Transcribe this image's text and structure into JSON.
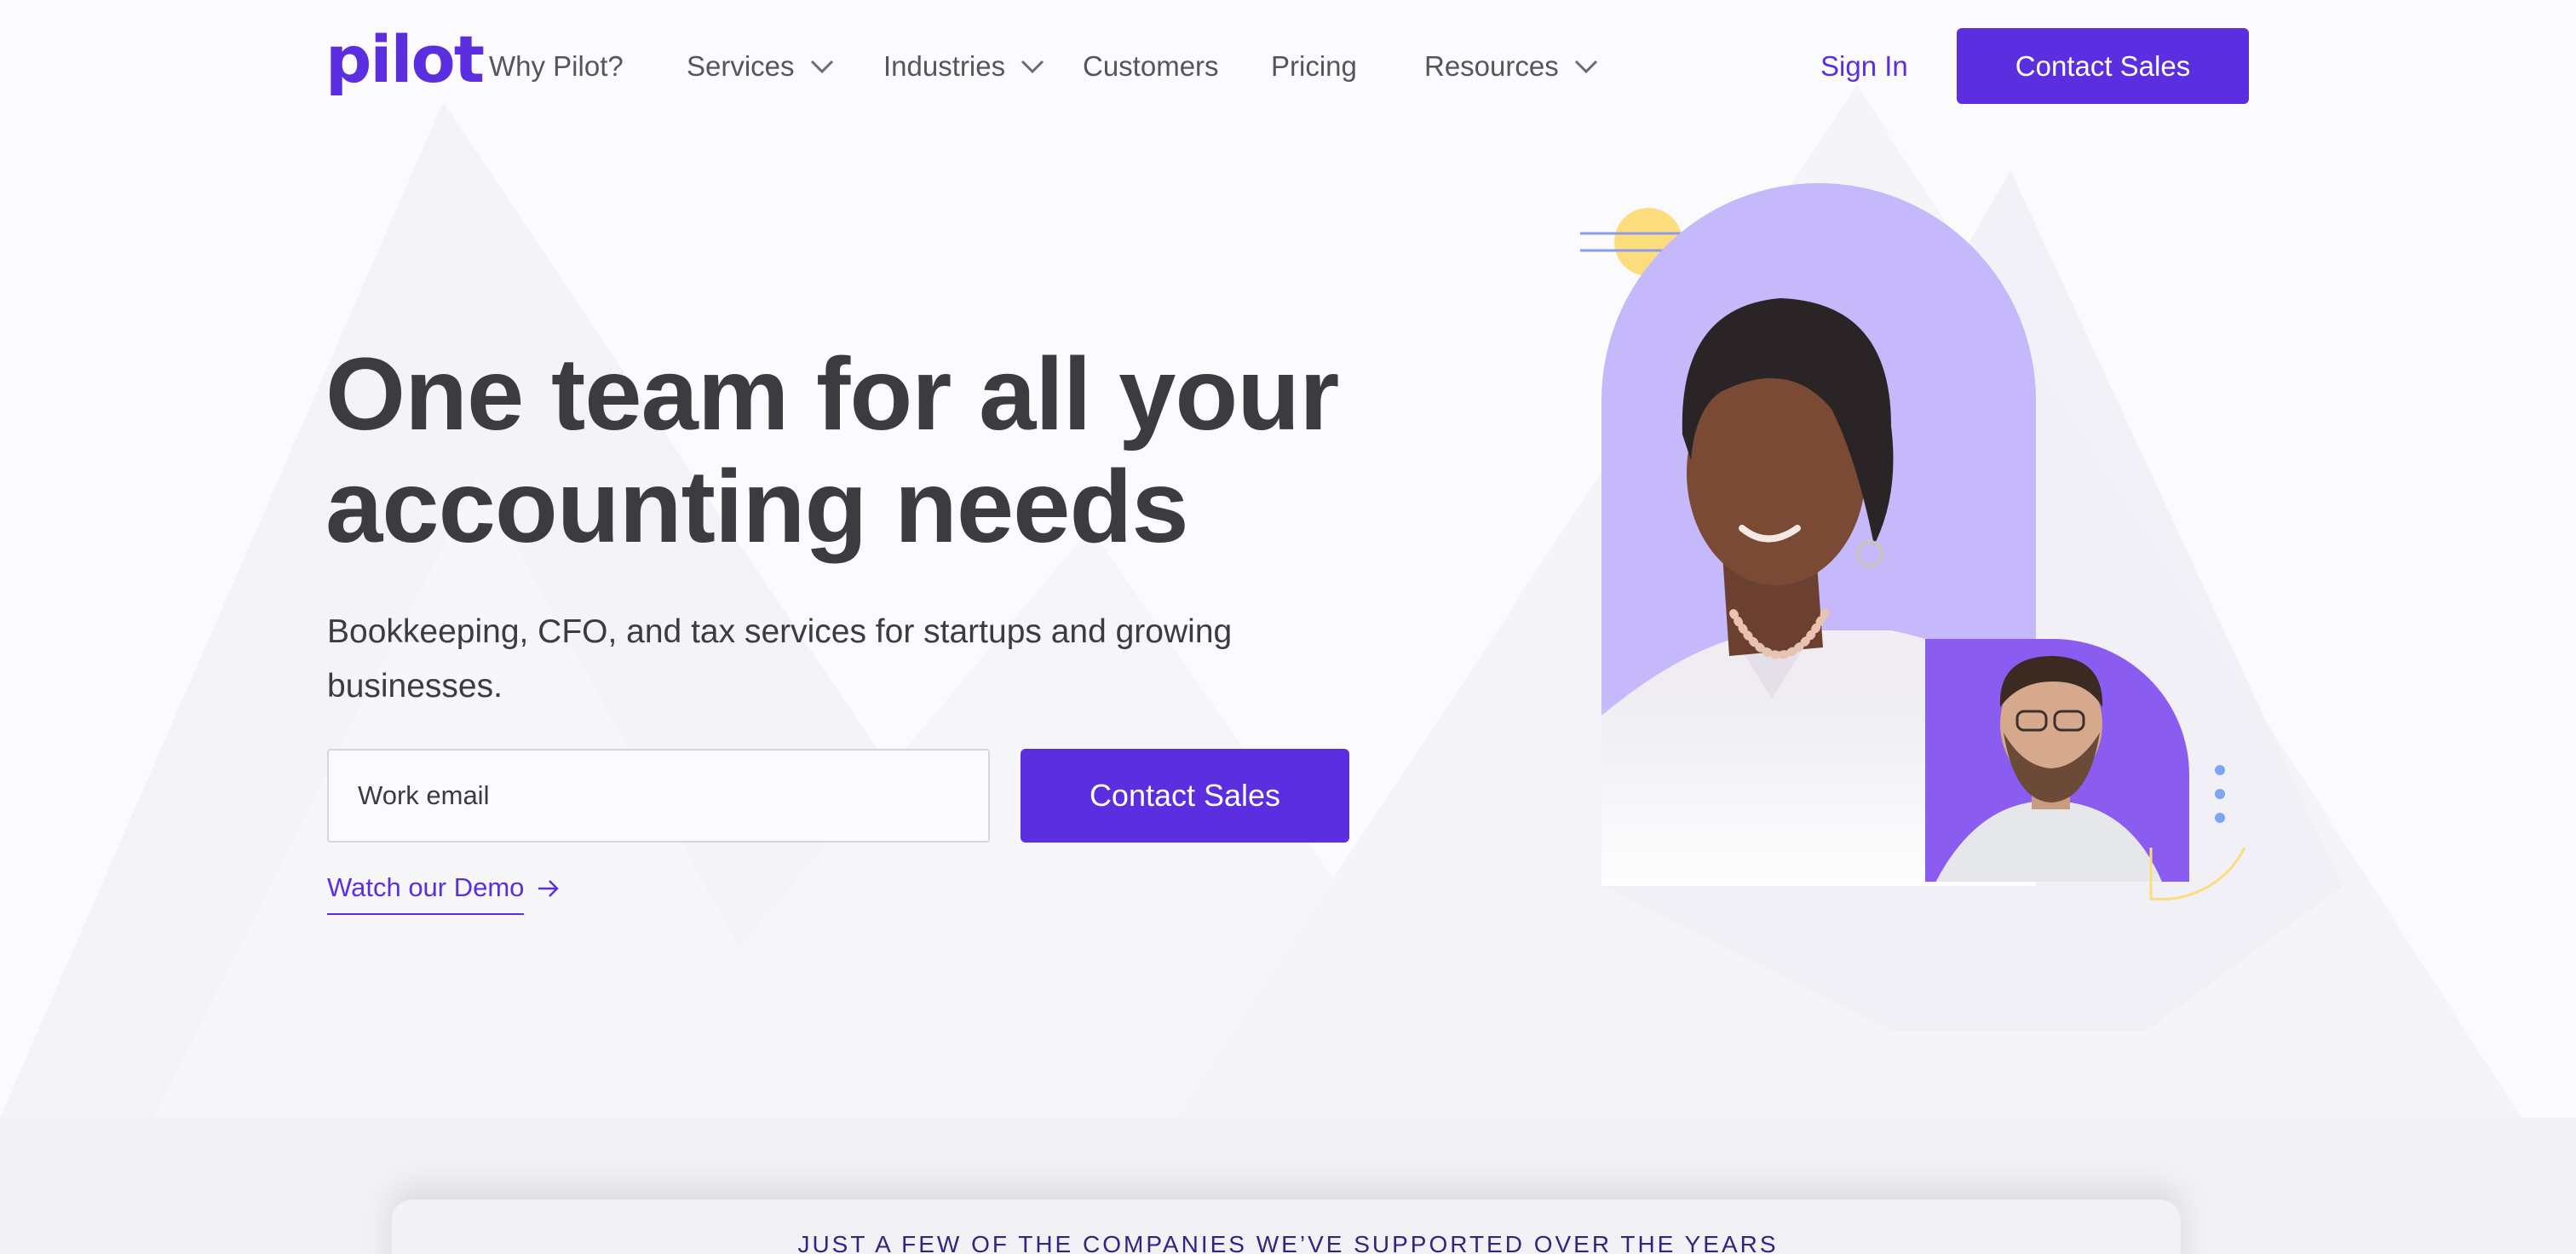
{
  "brand": {
    "logo_text": "pilot",
    "accent_color": "#5b2fe0"
  },
  "nav": {
    "items": [
      {
        "label": "Why Pilot?",
        "has_dropdown": false
      },
      {
        "label": "Services",
        "has_dropdown": true
      },
      {
        "label": "Industries",
        "has_dropdown": true
      },
      {
        "label": "Customers",
        "has_dropdown": false
      },
      {
        "label": "Pricing",
        "has_dropdown": false
      },
      {
        "label": "Resources",
        "has_dropdown": true
      }
    ],
    "sign_in": "Sign In",
    "cta": "Contact Sales"
  },
  "hero": {
    "headline": "One team for all your accounting needs",
    "subhead": "Bookkeeping, CFO, and tax services for startups and growing businesses.",
    "email_placeholder": "Work email",
    "cta": "Contact Sales",
    "demo_link": "Watch our Demo",
    "colors": {
      "lavender": "#c5b8fb",
      "violet": "#8a5cf0",
      "sun": "#fcdc7c",
      "dots": "#7ea6f0"
    }
  },
  "companies": {
    "label": "JUST A FEW OF THE COMPANIES WE’VE SUPPORTED OVER THE YEARS"
  }
}
